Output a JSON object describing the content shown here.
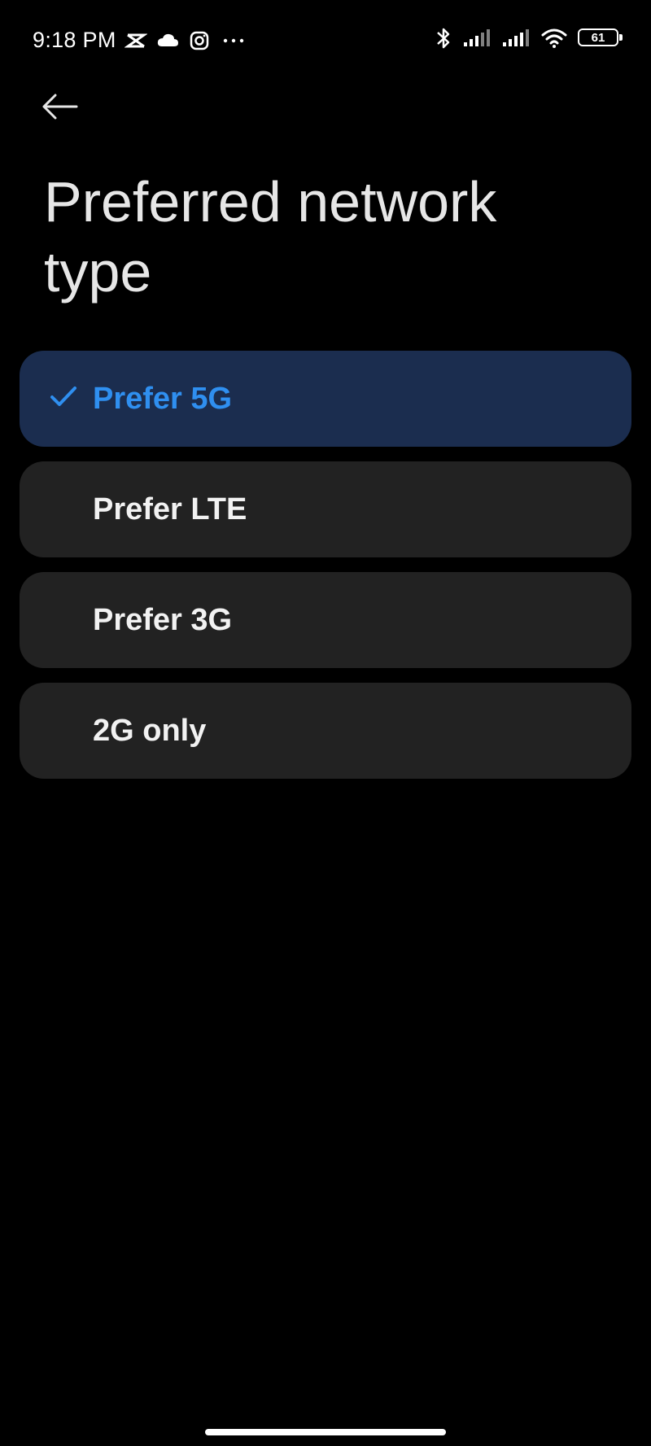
{
  "status_bar": {
    "time": "9:18 PM",
    "left_icons": [
      "capcut-icon",
      "cloud-icon",
      "instagram-icon",
      "more-dots-icon"
    ],
    "right_icons": [
      "bluetooth-icon",
      "signal-icon",
      "signal-icon",
      "wifi-icon",
      "battery-icon"
    ],
    "battery_level": "61"
  },
  "header": {
    "back_icon": "arrow-left-icon",
    "title": "Preferred network type"
  },
  "options": [
    {
      "label": "Prefer 5G",
      "selected": true
    },
    {
      "label": "Prefer LTE",
      "selected": false
    },
    {
      "label": "Prefer 3G",
      "selected": false
    },
    {
      "label": "2G only",
      "selected": false
    }
  ],
  "colors": {
    "background": "#000000",
    "item_background": "#222222",
    "selected_background": "#1b2d4f",
    "accent": "#2f8ff0"
  }
}
